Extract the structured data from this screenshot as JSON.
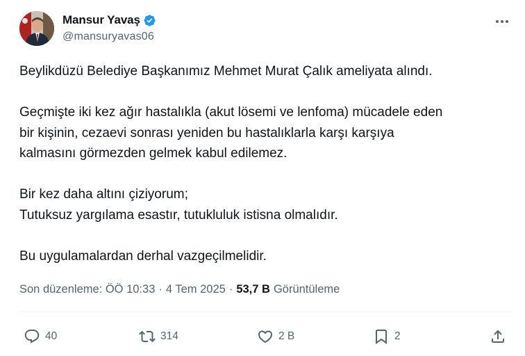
{
  "author": {
    "display_name": "Mansur Yavaş",
    "handle": "@mansuryavas06",
    "verified": true
  },
  "tweet": {
    "paragraphs": [
      [
        "Beylikdüzü Belediye Başkanımız Mehmet Murat Çalık ameliyata alındı."
      ],
      [
        "Geçmişte iki kez ağır hastalıkla (akut lösemi ve lenfoma) mücadele eden",
        "bir kişinin, cezaevi sonrası yeniden bu hastalıklarla karşı karşıya",
        "kalmasını görmezden gelmek kabul edilemez."
      ],
      [
        "Bir kez daha altını çiziyorum;",
        "Tutuksuz yargılama esastır, tutukluluk istisna olmalıdır."
      ],
      [
        "Bu uygulamalardan derhal vazgeçilmelidir."
      ]
    ]
  },
  "meta": {
    "edited_label": "Son düzenleme: ÖÖ 10:33",
    "separator": "·",
    "date": "4 Tem 2025",
    "views_count": "53,7 B",
    "views_label": "Görüntüleme"
  },
  "actions": {
    "replies": "40",
    "reposts": "314",
    "likes": "2 B",
    "bookmarks": "2"
  },
  "colors": {
    "text": "#0f1419",
    "secondary": "#536471",
    "verified": "#1d9bf0",
    "divider": "#eff3f4"
  },
  "icons": [
    "more-icon",
    "verified-badge-icon",
    "reply-icon",
    "repost-icon",
    "like-icon",
    "bookmark-icon",
    "share-icon"
  ]
}
